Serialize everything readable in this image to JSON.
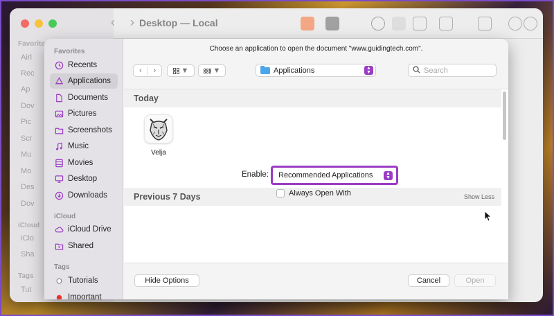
{
  "finder": {
    "title": "Desktop — Local",
    "sidebar_bg_items": [
      "Favorites",
      "Airl",
      "Rec",
      "Ap",
      "Dov",
      "Pic",
      "Scr",
      "Mu",
      "Mo",
      "Des",
      "Dov",
      "iCloud",
      "iClo",
      "Sha",
      "Tags",
      "Tut"
    ]
  },
  "dialog": {
    "prompt": "Choose an application to open the document \"www.guidingtech.com\".",
    "location": "Applications",
    "search_placeholder": "Search",
    "sections": {
      "today": "Today",
      "previous": "Previous 7 Days",
      "show_less": "Show Less"
    },
    "app": {
      "name": "Velja"
    },
    "enable_label": "Enable:",
    "enable_value": "Recommended Applications",
    "always_open_with": "Always Open With",
    "buttons": {
      "hide_options": "Hide Options",
      "cancel": "Cancel",
      "open": "Open"
    }
  },
  "sidebar": {
    "favorites_heading": "Favorites",
    "favorites": [
      {
        "label": "Recents",
        "icon": "clock-icon"
      },
      {
        "label": "Applications",
        "icon": "applications-icon",
        "active": true
      },
      {
        "label": "Documents",
        "icon": "document-icon"
      },
      {
        "label": "Pictures",
        "icon": "picture-icon"
      },
      {
        "label": "Screenshots",
        "icon": "folder-icon"
      },
      {
        "label": "Music",
        "icon": "music-icon"
      },
      {
        "label": "Movies",
        "icon": "film-icon"
      },
      {
        "label": "Desktop",
        "icon": "desktop-icon"
      },
      {
        "label": "Downloads",
        "icon": "download-icon"
      }
    ],
    "icloud_heading": "iCloud",
    "icloud": [
      {
        "label": "iCloud Drive",
        "icon": "cloud-icon"
      },
      {
        "label": "Shared",
        "icon": "shared-folder-icon"
      }
    ],
    "tags_heading": "Tags",
    "tags": [
      {
        "label": "Tutorials",
        "color": "#ffffff"
      },
      {
        "label": "Important",
        "color": "#e8322c"
      }
    ]
  },
  "colors": {
    "accent": "#9b3cc4",
    "folder_blue": "#4ea6ea"
  }
}
